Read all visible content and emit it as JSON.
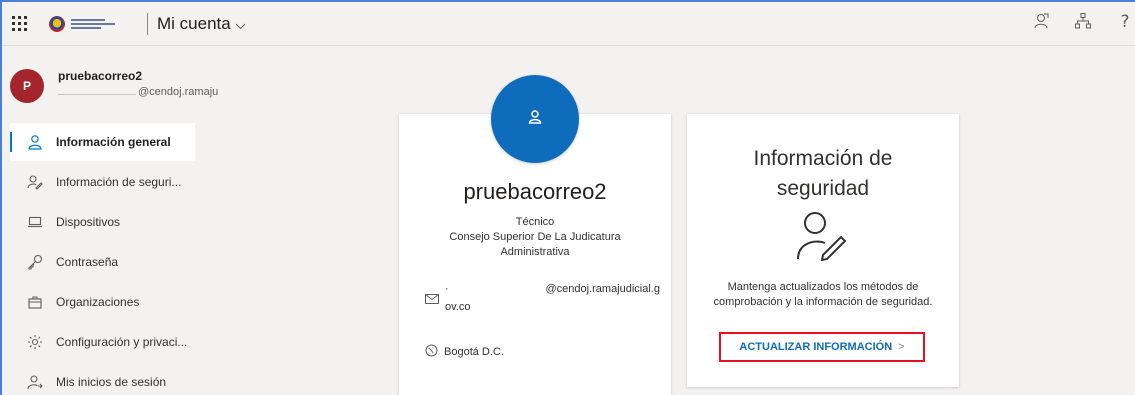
{
  "header": {
    "app_title": "Mi cuenta",
    "icons": [
      "feedback-icon",
      "org-chart-icon",
      "help-icon"
    ]
  },
  "user": {
    "initial": "P",
    "name": "pruebacorreo2",
    "email_suffix": "@cendoj.ramaju"
  },
  "sidebar": {
    "items": [
      {
        "label": "Información general",
        "icon": "person-icon",
        "active": true
      },
      {
        "label": "Información de seguri...",
        "icon": "security-info-icon",
        "active": false
      },
      {
        "label": "Dispositivos",
        "icon": "laptop-icon",
        "active": false
      },
      {
        "label": "Contraseña",
        "icon": "key-icon",
        "active": false
      },
      {
        "label": "Organizaciones",
        "icon": "briefcase-icon",
        "active": false
      },
      {
        "label": "Configuración y privaci...",
        "icon": "gear-icon",
        "active": false
      },
      {
        "label": "Mis inicios de sesión",
        "icon": "sign-in-icon",
        "active": false
      }
    ]
  },
  "profile_card": {
    "name": "pruebacorreo2",
    "role_line1": "Técnico",
    "role_line2": "Consejo Superior De La Judicatura",
    "role_line3": "Administrativa",
    "email_part1": "@cendoj.ramajudicial.g",
    "email_part2": "ov.co",
    "location": "Bogotá D.C."
  },
  "security_card": {
    "title_line1": "Información de",
    "title_line2": "seguridad",
    "description_line1": "Mantenga actualizados los métodos de",
    "description_line2": "comprobación y la información de seguridad.",
    "button_label": "ACTUALIZAR INFORMACIÓN",
    "button_chevron": ">"
  },
  "colors": {
    "accent": "#0078d4",
    "avatar_small": "#a4262c",
    "avatar_large": "#0f6cbd",
    "highlight_box": "#e81123"
  }
}
